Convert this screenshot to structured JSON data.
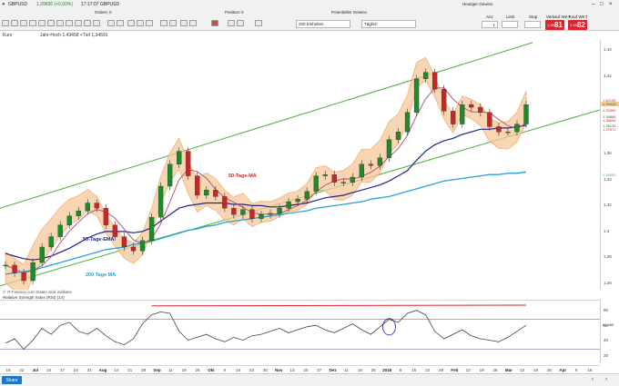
{
  "toolbar": {
    "symbol": "GBPUSD",
    "change": "1,39836 (+0,60%)",
    "time": "17:17:07",
    "time_symbol": "GBPUSD",
    "orders_label": "Orders:",
    "orders_value": "0",
    "position_label": "Position:",
    "position_value": "0",
    "units": "200 Einheiten",
    "potential_label": "Potentieller Gewinn",
    "timeframe": "Täglich",
    "current_gain_label": "Heutiger Gewinn",
    "qty_label": "Anz",
    "qty_value": "1",
    "limit_label": "Limit",
    "stop_label": "Stop",
    "sell_label": "Verkauf WKT",
    "buy_label": "Kauf WKT",
    "sell_price_small": "1,39",
    "sell_price_big": "81",
    "buy_price_small": "1,39",
    "buy_price_big": "82"
  },
  "info_line": {
    "label": "Kurs",
    "ohlc": "Jahr-Hoch 1,43458 +Tief 1,34591"
  },
  "chart_labels": {
    "ma50": "50-Tage-MA",
    "ema": "50-Tage-EMA",
    "ma200": "200 Tage MA"
  },
  "source_text": "© IT-Finance.com Daten sind indikativ",
  "rsi_title": "Relative Strength Index (RSI) (14)",
  "price_axis": {
    "ticks": [
      "1,44",
      "1,42",
      "1,4",
      "1,38",
      "1,36",
      "1,34",
      "1,32",
      "1,3",
      "1,28",
      "1,26"
    ],
    "tags": [
      "1,40156",
      "1,39828",
      "1,39365",
      "1,38888",
      "1,38606",
      "1,38135",
      "1,37870",
      "1,34351"
    ]
  },
  "rsi_axis": {
    "ticks": [
      "80",
      "60",
      "40",
      "20"
    ],
    "tag": "61,985"
  },
  "x_axis": {
    "labels": [
      "16",
      "22",
      "Jul",
      "10",
      "17",
      "24",
      "31",
      "Aug",
      "14",
      "21",
      "28",
      "Sep",
      "11",
      "18",
      "25",
      "Okt",
      "9",
      "16",
      "23",
      "30",
      "Nov",
      "13",
      "20",
      "27",
      "Dez",
      "11",
      "18",
      "25",
      "2018",
      "8",
      "15",
      "22",
      "29",
      "Feb",
      "12",
      "19",
      "26",
      "Mar",
      "12",
      "19",
      "26",
      "Apr",
      "9",
      "16"
    ],
    "bold": [
      "Jul",
      "Aug",
      "Sep",
      "Okt",
      "Nov",
      "Dez",
      "2018",
      "Feb",
      "Mar",
      "Apr"
    ]
  },
  "bottom": {
    "share_label": "Share"
  },
  "colors": {
    "up": "#1f8a2a",
    "down": "#c62828",
    "band": "#f6c89a",
    "ema": "#23238a",
    "ma50": "#b04a70",
    "ma200": "#29a3d6",
    "channel": "#4caf3a",
    "rsi": "#444444",
    "rsi_line": "#7777aa",
    "res_line": "#d9262e"
  },
  "chart_data": {
    "type": "candlestick",
    "series": [
      {
        "name": "GBPUSD",
        "close": [
          1.274,
          1.268,
          1.262,
          1.276,
          1.288,
          1.296,
          1.305,
          1.312,
          1.316,
          1.322,
          1.318,
          1.305,
          1.296,
          1.288,
          1.285,
          1.293,
          1.311,
          1.335,
          1.352,
          1.362,
          1.343,
          1.328,
          1.332,
          1.327,
          1.318,
          1.313,
          1.317,
          1.31,
          1.313,
          1.314,
          1.318,
          1.323,
          1.325,
          1.331,
          1.343,
          1.344,
          1.338,
          1.338,
          1.342,
          1.352,
          1.351,
          1.357,
          1.371,
          1.377,
          1.392,
          1.418,
          1.423,
          1.41,
          1.393,
          1.383,
          1.398,
          1.396,
          1.392,
          1.381,
          1.377,
          1.377,
          1.383,
          1.398
        ]
      },
      {
        "name": "50-Tage-EMA",
        "values": [
          1.283,
          1.281,
          1.279,
          1.278,
          1.279,
          1.281,
          1.284,
          1.287,
          1.291,
          1.295,
          1.298,
          1.3,
          1.3,
          1.3,
          1.299,
          1.3,
          1.303,
          1.308,
          1.313,
          1.318,
          1.32,
          1.321,
          1.322,
          1.322,
          1.322,
          1.321,
          1.321,
          1.32,
          1.32,
          1.319,
          1.319,
          1.32,
          1.321,
          1.322,
          1.324,
          1.326,
          1.327,
          1.328,
          1.33,
          1.332,
          1.334,
          1.336,
          1.339,
          1.343,
          1.347,
          1.355,
          1.362,
          1.367,
          1.37,
          1.372,
          1.375,
          1.377,
          1.379,
          1.379,
          1.38,
          1.38,
          1.381,
          1.382
        ]
      },
      {
        "name": "200 Tage MA",
        "values": [
          1.267,
          1.268,
          1.269,
          1.27,
          1.272,
          1.274,
          1.276,
          1.278,
          1.28,
          1.282,
          1.284,
          1.286,
          1.287,
          1.288,
          1.29,
          1.291,
          1.293,
          1.295,
          1.297,
          1.299,
          1.301,
          1.302,
          1.304,
          1.305,
          1.307,
          1.308,
          1.309,
          1.31,
          1.311,
          1.312,
          1.313,
          1.314,
          1.315,
          1.316,
          1.318,
          1.319,
          1.32,
          1.321,
          1.322,
          1.323,
          1.325,
          1.326,
          1.327,
          1.329,
          1.331,
          1.333,
          1.335,
          1.337,
          1.339,
          1.34,
          1.341,
          1.342,
          1.343,
          1.344,
          1.344,
          1.345,
          1.345,
          1.346
        ]
      },
      {
        "name": "RSI",
        "values": [
          38,
          44,
          30,
          42,
          58,
          50,
          62,
          66,
          54,
          50,
          58,
          48,
          40,
          36,
          44,
          64,
          76,
          80,
          78,
          54,
          42,
          46,
          50,
          44,
          40,
          46,
          42,
          48,
          50,
          54,
          58,
          52,
          56,
          60,
          62,
          56,
          52,
          58,
          64,
          56,
          50,
          60,
          70,
          66,
          78,
          82,
          76,
          54,
          44,
          50,
          56,
          48,
          44,
          42,
          40,
          46,
          54,
          62
        ]
      }
    ],
    "ylim": [
      1.255,
      1.448
    ],
    "rsi_ylim": [
      10,
      95
    ],
    "x_range": [
      "16",
      "16 Apr"
    ],
    "grid": false
  }
}
